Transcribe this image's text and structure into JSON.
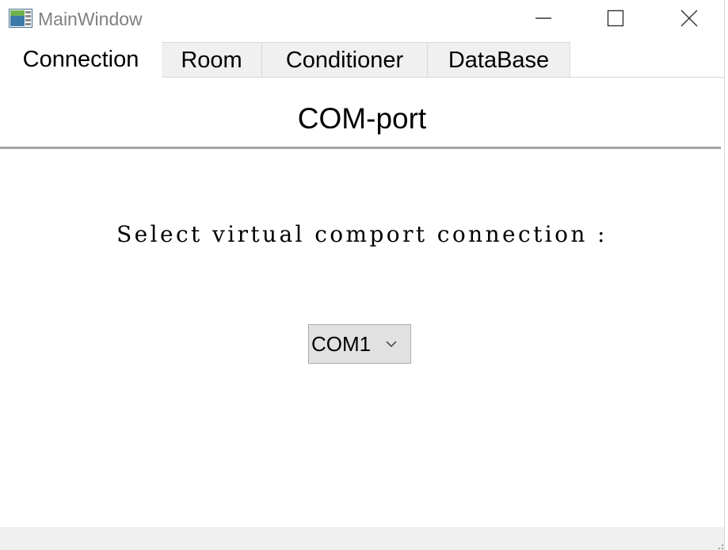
{
  "window": {
    "title": "MainWindow",
    "icon": "app-window-icon"
  },
  "titlebar": {
    "minimize_icon": "minimize-icon",
    "maximize_icon": "maximize-icon",
    "close_icon": "close-icon"
  },
  "tabs": [
    {
      "label": "Connection",
      "active": true
    },
    {
      "label": "Room",
      "active": false
    },
    {
      "label": "Conditioner",
      "active": false
    },
    {
      "label": "DataBase",
      "active": false
    }
  ],
  "connection": {
    "section_title": "COM-port",
    "prompt": "Select virtual comport connection :",
    "port_select": {
      "selected": "COM1",
      "icon": "chevron-down-icon"
    }
  },
  "colors": {
    "title_text": "#808080",
    "tab_inactive_bg": "#f0f0f0",
    "tab_border": "#d9d9d9",
    "divider": "#a3a3a3",
    "combo_bg": "#e1e1e1",
    "combo_border": "#adadad",
    "statusbar_bg": "#f0f0f0"
  }
}
